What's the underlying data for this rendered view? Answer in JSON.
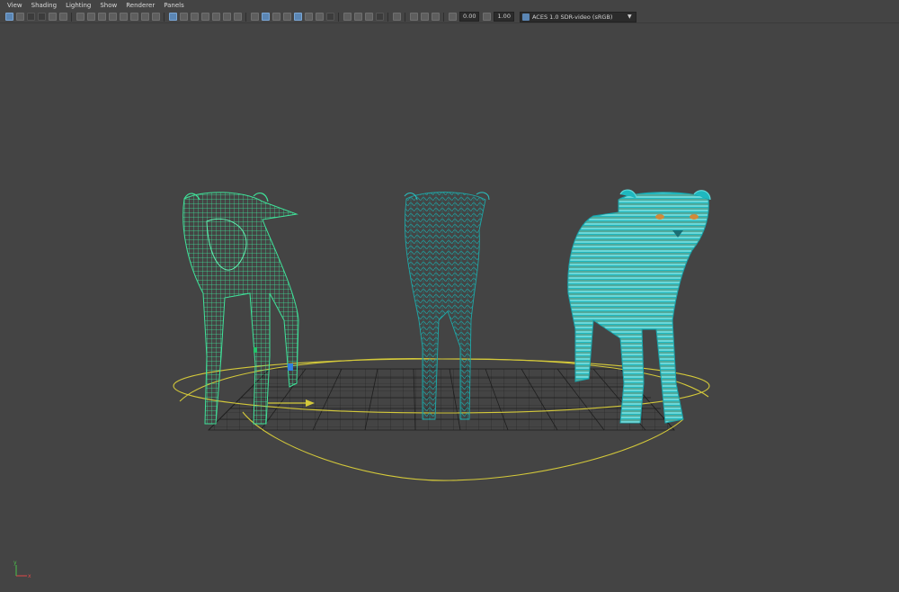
{
  "menu": [
    "View",
    "Shading",
    "Lighting",
    "Show",
    "Renderer",
    "Panels"
  ],
  "toolbar": {
    "exposure_value": "0.00",
    "gamma_value": "1.00",
    "color_space": "ACES 1.0 SDR-video (sRGB)"
  },
  "axis": {
    "x": "x",
    "y": "y"
  },
  "colors": {
    "background": "#444444",
    "wireframe_green": "#3fe39a",
    "wireframe_teal": "#1fa6a6",
    "shaded_teal": "#1fb8bf",
    "curve_yellow": "#d4c93a",
    "grid": "#1e1e1e"
  }
}
